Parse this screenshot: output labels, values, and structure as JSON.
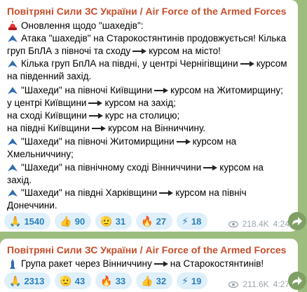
{
  "channel_name": "Повітряні Сили ЗС України / Air Force of the Armed Forces of ...",
  "message1": {
    "lines": [
      "Оновлення щодо \"шахедів\":",
      "Атака \"шахедів\" на Старокостянтинів продовжується! Кілька",
      "груп БпЛА з півночі та сходу",
      "курсом на місто!",
      "Кілька груп БпЛА на півдні, у центрі Чернігівщини",
      "курсом",
      "на південний захід.",
      "\"Шахеди\" на півночі Київщини",
      "курсом на Житомирщину;",
      "у центрі Київщини",
      "курсом на захід;",
      "на сході Київщини",
      "курс на столицю;",
      "на півдні Київщини",
      "курсом на Вінниччину.",
      "\"Шахеди\" на півночі Житомирщини",
      "курсом на",
      "Хмельниччину;",
      "\"Шахеди\" на північному сході Вінниччини",
      "курсом на",
      "захід.",
      "\"Шахеди\" на півдні Харківщини",
      "курсом на північ",
      "Донеччини."
    ],
    "reactions": [
      {
        "emoji": "🙏",
        "count": "1540"
      },
      {
        "emoji": "👍",
        "count": "90"
      },
      {
        "emoji": "🫡",
        "count": "31"
      },
      {
        "emoji": "🔥",
        "count": "27"
      },
      {
        "emoji": "⚡",
        "count": "18"
      }
    ],
    "views": "218.4K",
    "time": "4:24"
  },
  "message2": {
    "line_start": "Група ракет через Вінниччину",
    "line_end": "на Старокостянтинів!",
    "reactions": [
      {
        "emoji": "🙏",
        "count": "2313"
      },
      {
        "emoji": "🫡",
        "count": "43"
      },
      {
        "emoji": "🔥",
        "count": "33"
      },
      {
        "emoji": "👍",
        "count": "32"
      },
      {
        "emoji": "⚡",
        "count": "19"
      }
    ],
    "views": "211.6K",
    "time": "4:27"
  }
}
